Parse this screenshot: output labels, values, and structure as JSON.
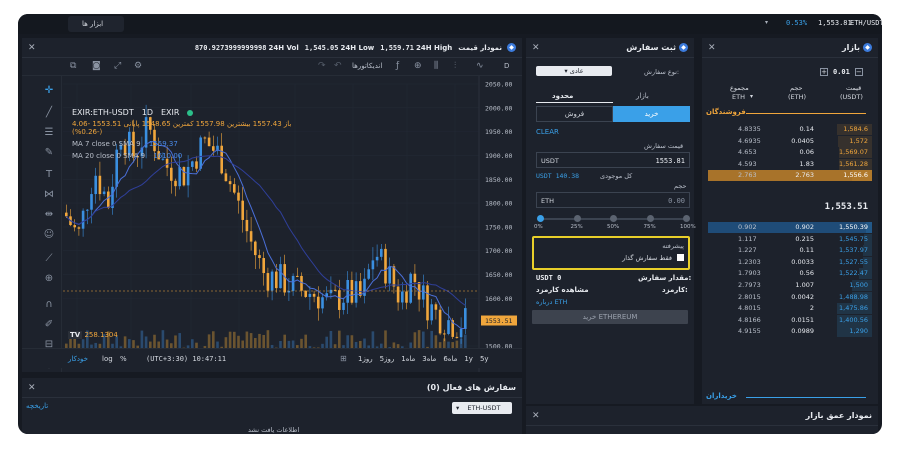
{
  "topbar": {
    "pair": "ETH/USDT",
    "price": "1,553.81",
    "change": "0.53%",
    "tools_tab": "ابزار ها"
  },
  "chart_panel": {
    "title": "نمودار قیمت",
    "stats": {
      "vol_label": "24H Vol",
      "vol_value": "870.9273999999998",
      "low_label": "24H Low",
      "low_value": "1,545.05",
      "high_label": "24H High",
      "high_value": "1,559.71"
    },
    "toolbar": {
      "indicators": "اندیکاتورها",
      "interval": "D"
    },
    "legend": {
      "symbol": "EXIR:ETH-USDT",
      "interval": "1D",
      "exchange": "EXIR",
      "ohlc": "باز 1557.43  بیشترین 1557.98  کمترین 1548.65  پایانی 1553.51 -4.06 (-0.26%)",
      "ma7": "MA 7 close 0 SMA 9",
      "ma7_value": "1559.37",
      "ma20": "MA 20 close 0 SMA 9",
      "ma20_value": "1610.00"
    },
    "price_axis": [
      "2050.00",
      "2000.00",
      "1950.00",
      "1900.00",
      "1850.00",
      "1800.00",
      "1750.00",
      "1700.00",
      "1650.00",
      "1600.00",
      "1553.51",
      "1500.00"
    ],
    "time_axis": [
      "Jul",
      "15",
      "آگوست",
      "15",
      "Sep",
      "15",
      "Oct",
      "15"
    ],
    "volume_label": "258.1304",
    "footer": {
      "ranges": [
        "5y",
        "1y",
        "6ماه",
        "3ماه",
        "1ماه",
        "5روز",
        "1روز"
      ],
      "time": "(UTC+3:30) 10:47:11",
      "percent": "%",
      "log": "log",
      "auto": "خودکار"
    }
  },
  "chart_data": {
    "type": "candlestick",
    "symbol": "EXIR:ETH-USDT",
    "interval": "1D",
    "y_range": [
      1500,
      2050
    ],
    "last_price": 1553.51,
    "phases": [
      {
        "period": "Jul",
        "range": [
          1700,
          1950
        ]
      },
      {
        "period": "Aug early",
        "range": [
          1830,
          2010
        ]
      },
      {
        "period": "Aug late",
        "range": [
          1600,
          1800
        ]
      },
      {
        "period": "Sep",
        "range": [
          1560,
          1660
        ]
      },
      {
        "period": "Oct early",
        "range": [
          1570,
          1720
        ]
      },
      {
        "period": "Oct mid",
        "range": [
          1540,
          1620
        ]
      }
    ],
    "series": [
      {
        "name": "MA 7 close 0 SMA 9",
        "last": 1559.37,
        "color": "#4a6fd8"
      },
      {
        "name": "MA 20 close 0 SMA 9",
        "last": 1610.0,
        "color": "#2f3f9a"
      }
    ]
  },
  "open_orders": {
    "title": "سفارش های فعال (0)",
    "pair_select": "ETH-USDT",
    "history": "تاریخچه",
    "empty": "اطلاعات یافت نشد"
  },
  "order_panel": {
    "title": "ثبت سفارش",
    "order_type_label": "نوع سفارش:",
    "order_type_value": "عادی",
    "tabs": {
      "market": "بازار",
      "limit": "محدود"
    },
    "buy": "خرید",
    "sell": "فروش",
    "clear": "CLEAR",
    "price_label": "قیمت سفارش",
    "price_currency": "USDT",
    "price_value": "1553.81",
    "balance_label": "کل موجودی",
    "balance_value": "USDT 140.38",
    "volume_label": "حجم",
    "volume_currency": "ETH",
    "volume_value": "0.00",
    "slider_marks": [
      "0%",
      "25%",
      "50%",
      "75%",
      "100%"
    ],
    "advanced": "پیشرفته",
    "maker_only": "فقط سفارش گذار",
    "amount_label": "مقدار سفارش:",
    "amount_value": "USDT 0",
    "fee_label": "کارمزد:",
    "fee_value": "مشاهده کارمزد",
    "about": "درباره ETH",
    "submit": "خرید ETHEREUM"
  },
  "market_panel": {
    "title": "بازار",
    "precision": "0.01",
    "col_total": "مجموع",
    "col_total_unit": "ETH",
    "col_volume": "حجم",
    "col_volume_unit": "(ETH)",
    "col_price": "قیمت",
    "col_price_unit": "(USDT)",
    "sellers": "فروشندگان",
    "buyers": "خریداران",
    "mid_price": "1,553.51",
    "asks": [
      {
        "total": "4.8335",
        "volume": "0.14",
        "price": "1,584.6"
      },
      {
        "total": "4.6935",
        "volume": "0.0405",
        "price": "1,572"
      },
      {
        "total": "4.653",
        "volume": "0.06",
        "price": "1,569.07"
      },
      {
        "total": "4.593",
        "volume": "1.83",
        "price": "1,561.28"
      },
      {
        "total": "2.763",
        "volume": "2.763",
        "price": "1,556.6"
      }
    ],
    "bids": [
      {
        "total": "0.902",
        "volume": "0.902",
        "price": "1,550.39"
      },
      {
        "total": "1.117",
        "volume": "0.215",
        "price": "1,545.75"
      },
      {
        "total": "1.227",
        "volume": "0.11",
        "price": "1,537.97"
      },
      {
        "total": "1.2303",
        "volume": "0.0033",
        "price": "1,527.55"
      },
      {
        "total": "1.7903",
        "volume": "0.56",
        "price": "1,522.47"
      },
      {
        "total": "2.7973",
        "volume": "1.007",
        "price": "1,500"
      },
      {
        "total": "2.8015",
        "volume": "0.0042",
        "price": "1,488.98"
      },
      {
        "total": "4.8015",
        "volume": "2",
        "price": "1,475.86"
      },
      {
        "total": "4.8166",
        "volume": "0.0151",
        "price": "1,400.56"
      },
      {
        "total": "4.9155",
        "volume": "0.0989",
        "price": "1,290"
      }
    ]
  },
  "depth_panel": {
    "title": "نمودار عمق بازار"
  },
  "colors": {
    "bg": "#161a22",
    "panel": "#1d222c",
    "accent": "#3aa0e8",
    "buy": "#2f93df",
    "sell": "#f0a63c",
    "highlight": "#e8cf2a"
  }
}
